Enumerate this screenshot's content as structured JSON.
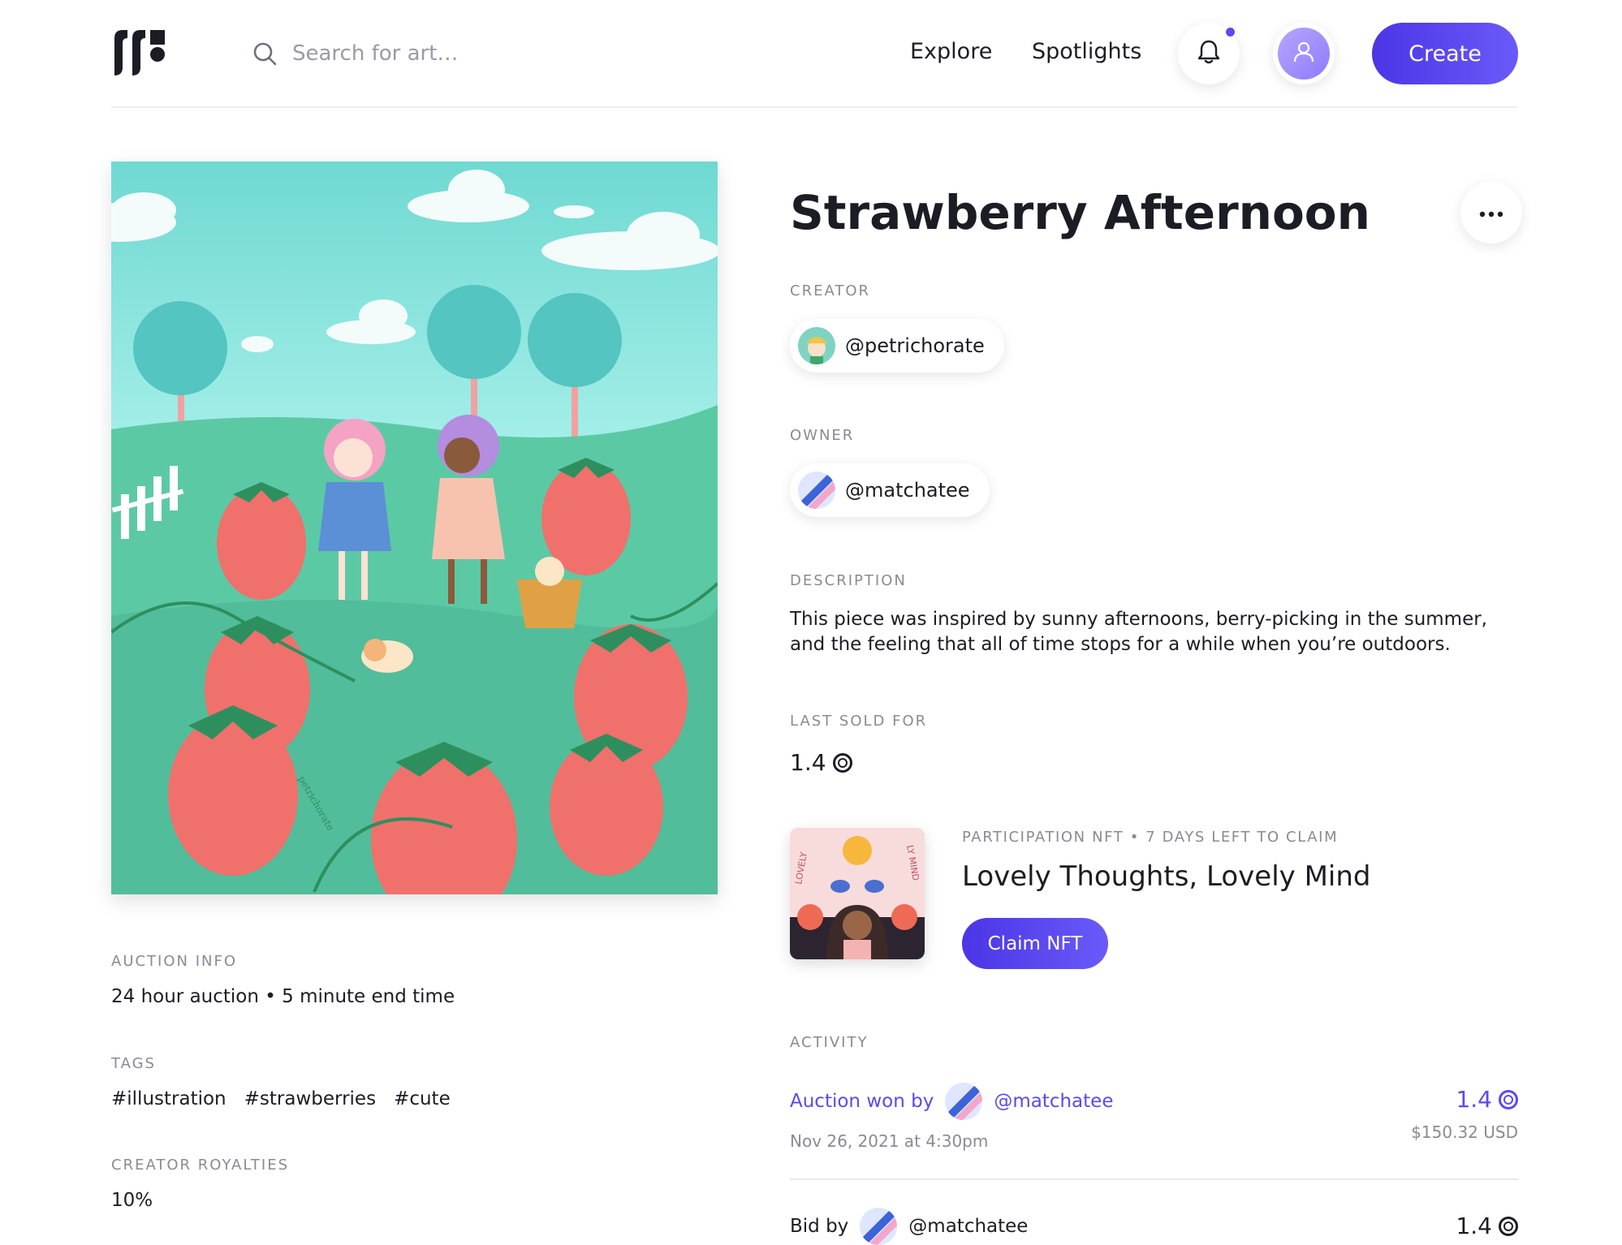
{
  "header": {
    "search_placeholder": "Search for art…",
    "nav": [
      "Explore",
      "Spotlights"
    ],
    "create_label": "Create"
  },
  "artwork": {
    "signature": "petrichorate"
  },
  "auction_info": {
    "label": "AUCTION INFO",
    "value": "24 hour auction • 5 minute end time"
  },
  "tags": {
    "label": "TAGS",
    "items": [
      "#illustration",
      "#strawberries",
      "#cute"
    ]
  },
  "royalties": {
    "label": "CREATOR ROYALTIES",
    "value": "10%"
  },
  "title": "Strawberry Afternoon",
  "creator": {
    "label": "CREATOR",
    "handle": "@petrichorate"
  },
  "owner": {
    "label": "OWNER",
    "handle": "@matchatee"
  },
  "description": {
    "label": "DESCRIPTION",
    "text": "This piece was inspired by sunny afternoons, berry-picking in the summer, and the feeling that all of time stops for a while when you’re outdoors."
  },
  "last_sold": {
    "label": "LAST SOLD FOR",
    "value": "1.4"
  },
  "participation": {
    "subtitle": "PARTICIPATION NFT • 7 DAYS LEFT TO CLAIM",
    "title": "Lovely Thoughts, Lovely Mind",
    "thumb_text_left": "LOVELY",
    "thumb_text_right": "LY MIND",
    "claim_label": "Claim NFT"
  },
  "activity": {
    "label": "ACTIVITY",
    "items": [
      {
        "action": "Auction won by",
        "handle": "@matchatee",
        "date": "Nov 26, 2021 at 4:30pm",
        "amount": "1.4",
        "usd": "$150.32 USD"
      },
      {
        "action": "Bid by",
        "handle": "@matchatee",
        "amount": "1.4"
      }
    ]
  },
  "colors": {
    "accent": "#5b49f2",
    "sky": "#7fe3dd",
    "grass": "#5cc9a5",
    "strawberry": "#f0706c"
  }
}
